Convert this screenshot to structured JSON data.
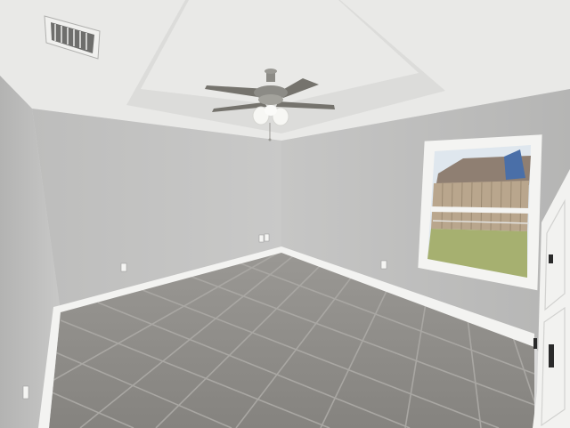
{
  "scene": {
    "kind": "empty room interior",
    "palette": {
      "ceiling": "#e9e9e7",
      "ceiling_shadow": "#dcdcda",
      "wall_left": "#c7c7c6",
      "wall_back": "#c2c2c1",
      "wall_right": "#bebebd",
      "baseboard": "#f3f3f1",
      "floor": "#8d8b87",
      "grout": "#a9a7a3",
      "window_frame": "#f4f4f2",
      "sky": "#dfe7ee",
      "fence": "#b9a68d",
      "grass": "#a6b070",
      "door": "#f2f2f0",
      "fan_metal": "#8c8b86",
      "fan_blade": "#75736d",
      "fan_glass": "#f7f7f4"
    },
    "objects": [
      {
        "name": "ceiling-fan",
        "icon": "ceiling-fan-icon"
      },
      {
        "name": "air-vent",
        "icon": "vent-grille-icon"
      },
      {
        "name": "window",
        "icon": "window-icon"
      },
      {
        "name": "door",
        "icon": "door-icon"
      },
      {
        "name": "wall-outlet",
        "icon": "outlet-icon"
      },
      {
        "name": "tile-floor",
        "icon": "tile-floor-icon"
      }
    ]
  }
}
